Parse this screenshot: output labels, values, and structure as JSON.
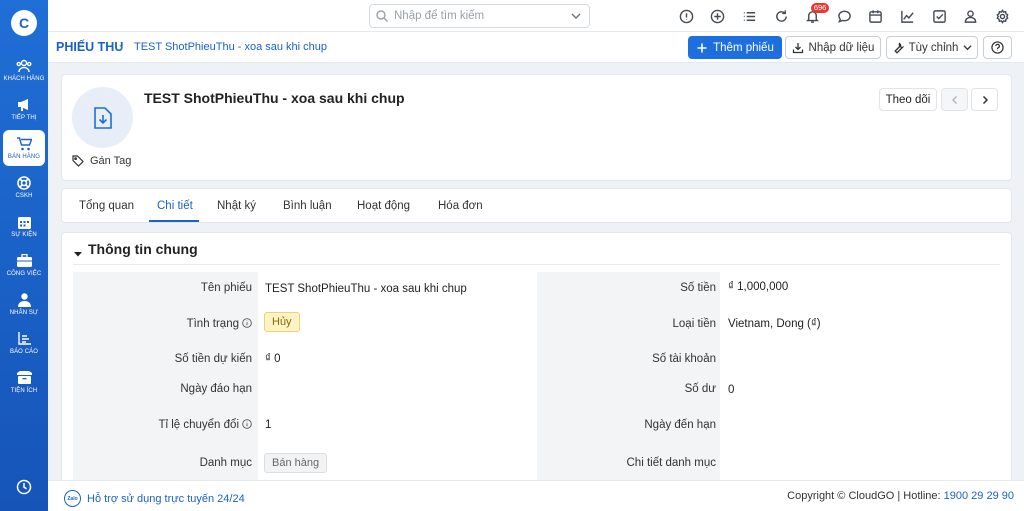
{
  "sidebar": {
    "logo": "C",
    "items": [
      {
        "label": "KHÁCH HÀNG",
        "icon": "users-icon"
      },
      {
        "label": "TIẾP THỊ",
        "icon": "megaphone-icon"
      },
      {
        "label": "BÁN HÀNG",
        "icon": "cart-icon",
        "active": true
      },
      {
        "label": "CSKH",
        "icon": "lifebuoy-icon"
      },
      {
        "label": "SỰ KIỆN",
        "icon": "calendar-icon"
      },
      {
        "label": "CÔNG VIỆC",
        "icon": "briefcase-icon"
      },
      {
        "label": "NHÂN SỰ",
        "icon": "person-icon"
      },
      {
        "label": "BÁO CÁO",
        "icon": "report-icon"
      },
      {
        "label": "TIỆN ÍCH",
        "icon": "box-icon"
      }
    ]
  },
  "topbar": {
    "search_placeholder": "Nhập để tìm kiếm",
    "notification_count": "696"
  },
  "breadcrumb": {
    "root": "PHIẾU THU",
    "separator": "›",
    "current": "TEST ShotPhieuThu - xoa sau khi chup"
  },
  "actions": {
    "add": "Thêm phiếu",
    "import": "Nhập dữ liệu",
    "customize": "Tùy chỉnh"
  },
  "record": {
    "title": "TEST ShotPhieuThu - xoa sau khi chup",
    "tag_label": "Gán Tag",
    "follow_label": "Theo dõi"
  },
  "tabs": [
    "Tổng quan",
    "Chi tiết",
    "Nhật ký",
    "Bình luận",
    "Hoạt động",
    "Hóa đơn"
  ],
  "section": {
    "title": "Thông tin chung",
    "left": [
      {
        "label": "Tên phiếu",
        "value": "TEST ShotPhieuThu - xoa sau khi chup"
      },
      {
        "label": "Tình trạng",
        "value": "Hủy"
      },
      {
        "label": "Số tiền dự kiến",
        "value": "₫ 0"
      },
      {
        "label": "Ngày đáo hạn",
        "value": ""
      },
      {
        "label": "Tỉ lệ chuyển đổi",
        "value": "1"
      },
      {
        "label": "Danh mục",
        "value": "Bán hàng"
      }
    ],
    "right": [
      {
        "label": "Số tiền",
        "value": "₫ 1,000,000"
      },
      {
        "label": "Loại tiền",
        "value": "Vietnam, Dong (₫)"
      },
      {
        "label": "Số tài khoản",
        "value": ""
      },
      {
        "label": "Số dư",
        "value": "0"
      },
      {
        "label": "Ngày đến hạn",
        "value": ""
      },
      {
        "label": "Chi tiết danh mục",
        "value": ""
      }
    ]
  },
  "footer": {
    "zalo": "Zalo",
    "support": "Hỗ trợ sử dụng trực tuyến 24/24",
    "copyright": "Copyright © CloudGO | Hotline: ",
    "hotline": "1900 29 29 90"
  },
  "colors": {
    "primary": "#1d6fe0",
    "sidebar": "#1a62c8",
    "warning_bg": "#fdf3c4"
  }
}
